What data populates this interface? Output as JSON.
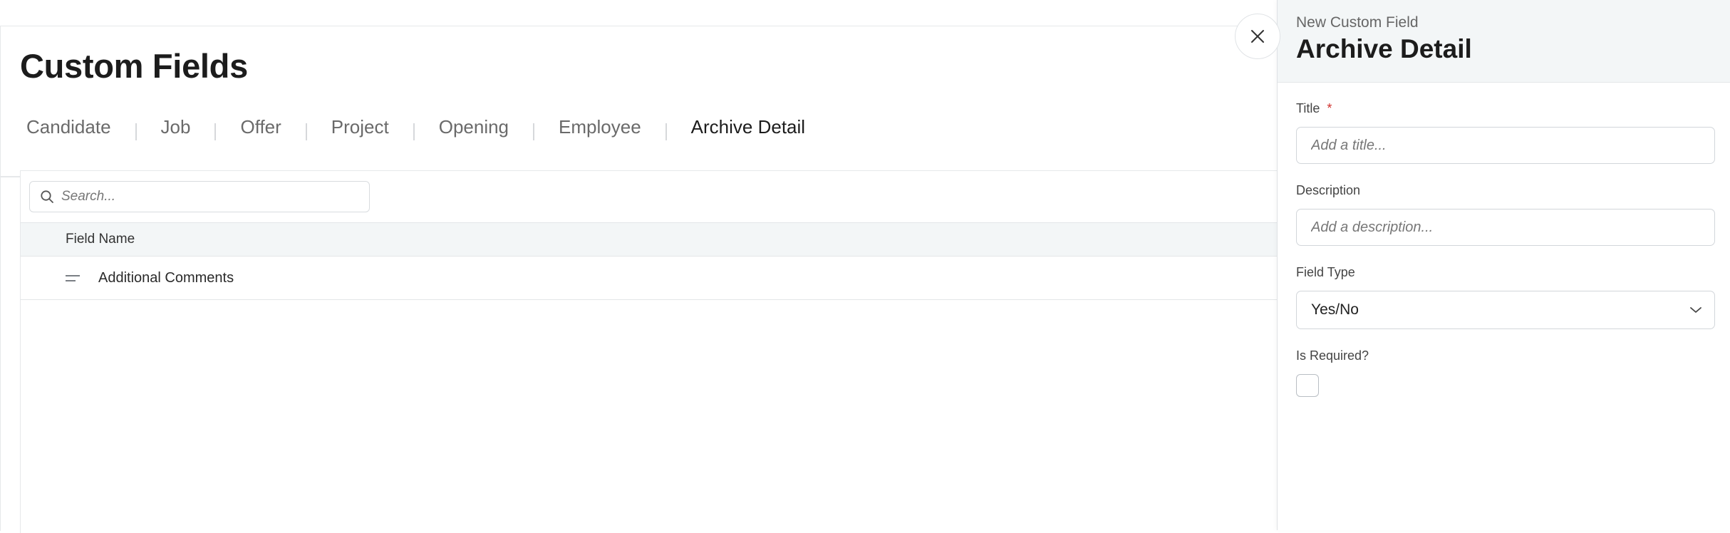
{
  "page": {
    "title": "Custom Fields",
    "tabs": [
      {
        "label": "Candidate"
      },
      {
        "label": "Job"
      },
      {
        "label": "Offer"
      },
      {
        "label": "Project"
      },
      {
        "label": "Opening"
      },
      {
        "label": "Employee"
      },
      {
        "label": "Archive Detail",
        "active": true
      }
    ]
  },
  "list": {
    "search_placeholder": "Search...",
    "column_header": "Field Name",
    "rows": [
      {
        "label": "Additional Comments"
      }
    ]
  },
  "panel": {
    "subtitle": "New Custom Field",
    "title": "Archive Detail",
    "title_label": "Title",
    "required_mark": "*",
    "title_placeholder": "Add a title...",
    "description_label": "Description",
    "description_placeholder": "Add a description...",
    "field_type_label": "Field Type",
    "field_type_value": "Yes/No",
    "is_required_label": "Is Required?"
  },
  "colors": {
    "accent": "#4b3a91",
    "required": "#d0312d",
    "header_bg": "#f3f6f7"
  },
  "icons": {
    "close": "close-icon",
    "search": "search-icon",
    "drag": "drag-handle-icon",
    "chevron": "chevron-down-icon"
  }
}
